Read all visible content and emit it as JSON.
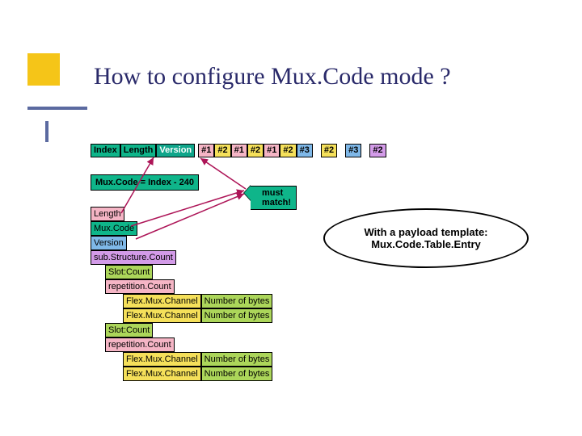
{
  "title": "How to configure Mux.Code mode ?",
  "header": {
    "index": "Index",
    "length": "Length",
    "version": "Version",
    "slots": [
      "#1",
      "#2",
      "#1",
      "#2",
      "#1",
      "#2",
      "#3",
      "#2",
      "#3",
      "#2"
    ]
  },
  "formula": "Mux.Code = Index - 240",
  "match_note": "must match!",
  "stack": {
    "length": "Length",
    "muxcode": "Mux.Code",
    "version": "Version",
    "subStructureCount": "sub.Structure.Count",
    "slotCount": "Slot:Count",
    "repetitionCount": "repetition.Count",
    "flexMuxChannel": "Flex.Mux.Channel",
    "numBytes": "Number of bytes"
  },
  "ellipse": {
    "line1": "With a payload template:",
    "line2": "Mux.Code.Table.Entry"
  }
}
